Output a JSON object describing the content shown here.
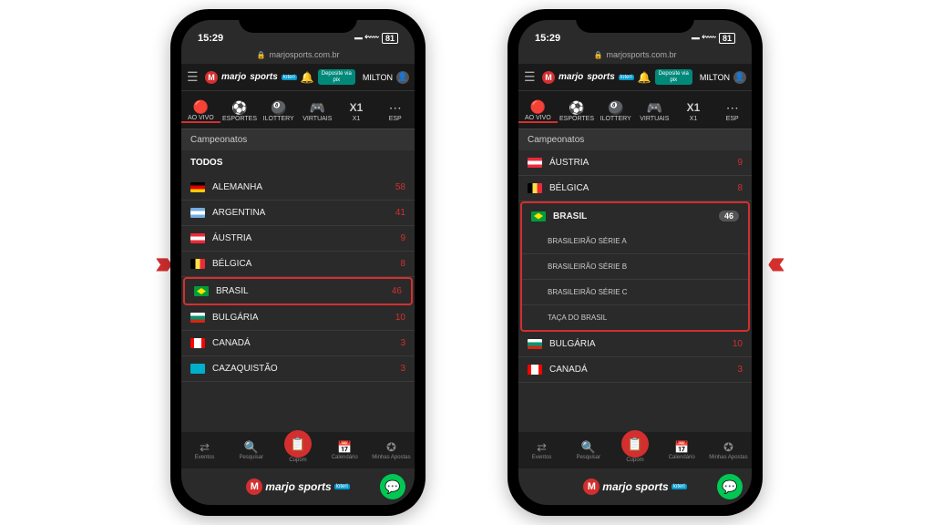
{
  "status": {
    "time": "15:29",
    "battery": "81"
  },
  "urlbar": {
    "url": "marjosports.com.br"
  },
  "header": {
    "brand1": "marjo",
    "brand2": "sports",
    "sub": "loteri",
    "pix_line1": "Deposite via",
    "pix_line2": "pix",
    "user": "MILTON"
  },
  "tabs": [
    {
      "label": "AO VIVO"
    },
    {
      "label": "ESPORTES"
    },
    {
      "label": "ILOTTERY"
    },
    {
      "label": "VIRTUAIS"
    },
    {
      "label": "X1"
    },
    {
      "label": "ESP"
    }
  ],
  "x1_icon": "X1",
  "campeonatos_label": "Campeonatos",
  "todos_label": "TODOS",
  "countries_left": [
    {
      "name": "ALEMANHA",
      "count": "58",
      "flag": "de"
    },
    {
      "name": "ARGENTINA",
      "count": "41",
      "flag": "ar"
    },
    {
      "name": "ÁUSTRIA",
      "count": "9",
      "flag": "at"
    },
    {
      "name": "BÉLGICA",
      "count": "8",
      "flag": "be"
    },
    {
      "name": "BRASIL",
      "count": "46",
      "flag": "br",
      "highlight": true
    },
    {
      "name": "BULGÁRIA",
      "count": "10",
      "flag": "bg"
    },
    {
      "name": "CANADÁ",
      "count": "3",
      "flag": "ca"
    },
    {
      "name": "CAZAQUISTÃO",
      "count": "3",
      "flag": "kz"
    }
  ],
  "countries_right_top": [
    {
      "name": "ÁUSTRIA",
      "count": "9",
      "flag": "at"
    },
    {
      "name": "BÉLGICA",
      "count": "8",
      "flag": "be"
    }
  ],
  "brasil_expanded": {
    "name": "BRASIL",
    "count": "46",
    "subs": [
      "BRASILEIRÃO SÉRIE A",
      "BRASILEIRÃO SÉRIE B",
      "BRASILEIRÃO SÉRIE C",
      "TAÇA DO BRASIL"
    ]
  },
  "countries_right_bottom": [
    {
      "name": "BULGÁRIA",
      "count": "10",
      "flag": "bg"
    },
    {
      "name": "CANADÁ",
      "count": "3",
      "flag": "ca"
    }
  ],
  "bottom_nav": [
    {
      "label": "Eventos"
    },
    {
      "label": "Pesquisar"
    },
    {
      "label": "Cupom"
    },
    {
      "label": "Calendário"
    },
    {
      "label": "Minhas Apostas"
    }
  ],
  "arrows": {
    "left": "›››",
    "right": "‹‹‹"
  }
}
